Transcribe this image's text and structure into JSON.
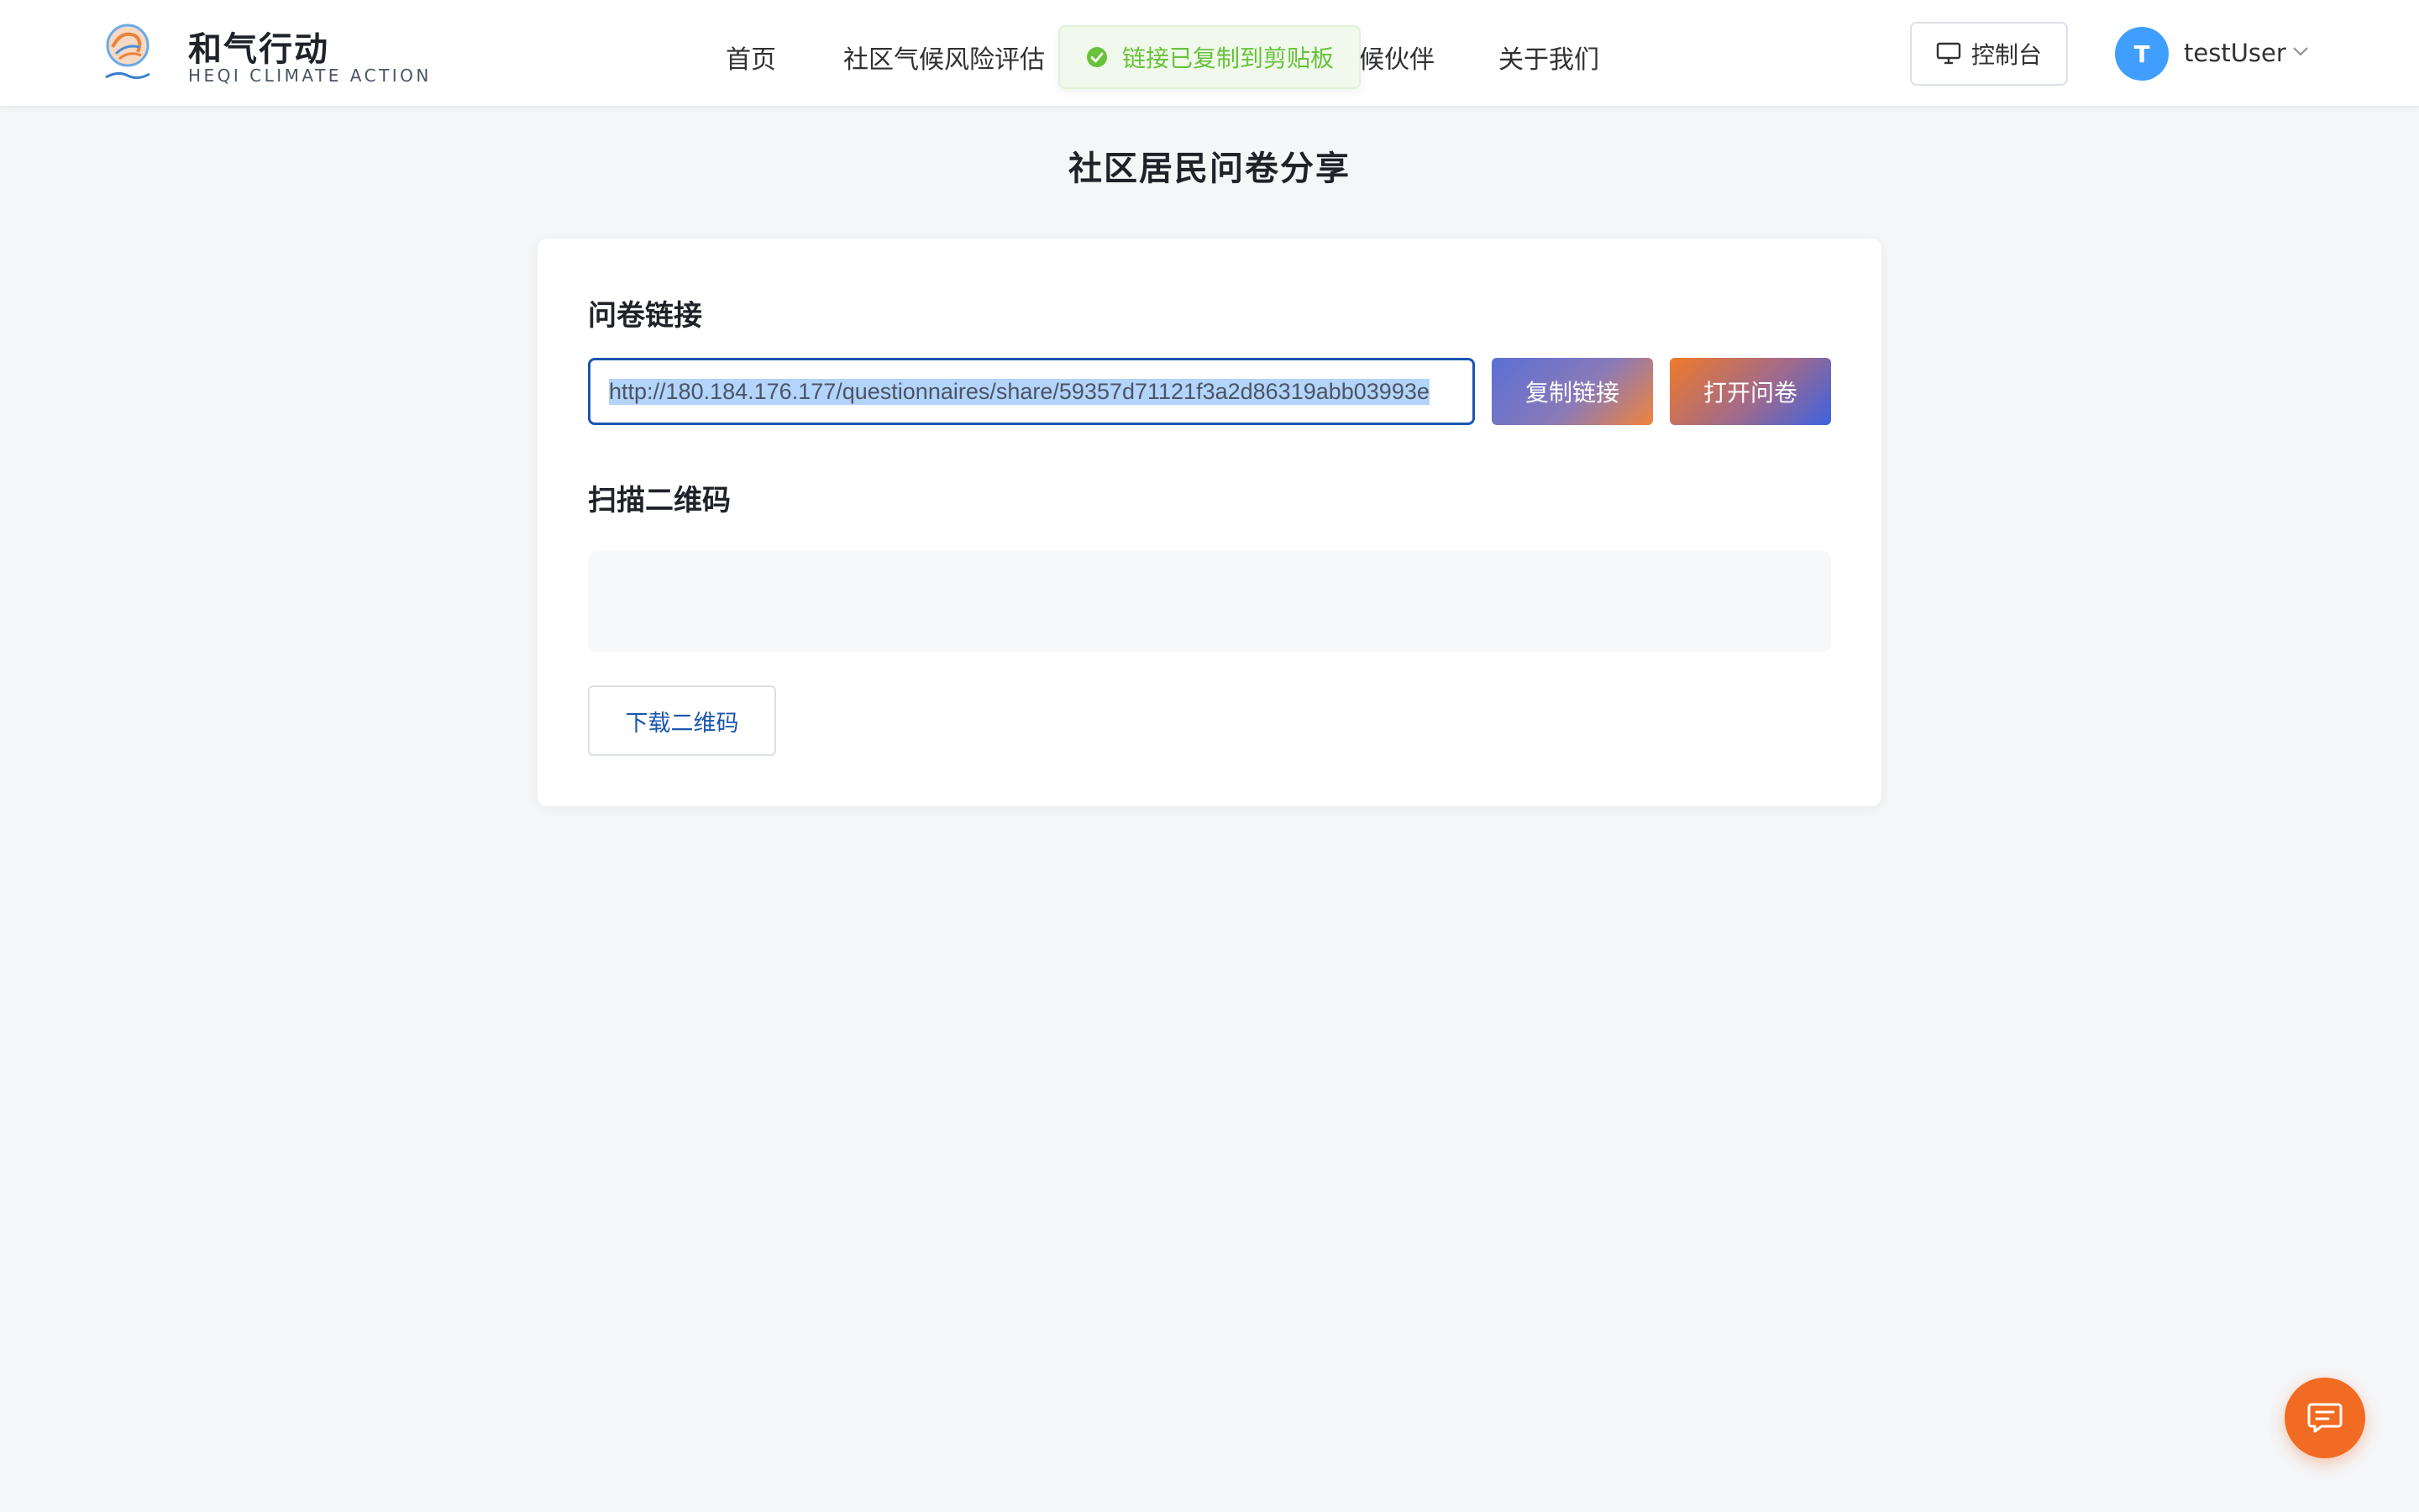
{
  "header": {
    "brand_name": "和气行动",
    "brand_sub": "HEQI CLIMATE ACTION",
    "nav": [
      {
        "label": "首页"
      },
      {
        "label": "社区气候风险评估"
      },
      {
        "label": "候伙伴"
      },
      {
        "label": "关于我们"
      }
    ],
    "console_label": "控制台",
    "avatar_initial": "T",
    "username": "testUser"
  },
  "toast": {
    "message": "链接已复制到剪贴板"
  },
  "main": {
    "page_title": "社区居民问卷分享",
    "link_section_title": "问卷链接",
    "link_value": "http://180.184.176.177/questionnaires/share/59357d71121f3a2d86319abb03993e",
    "copy_label": "复制链接",
    "open_label": "打开问卷",
    "qr_section_title": "扫描二维码",
    "download_label": "下载二维码"
  },
  "colors": {
    "accent_blue": "#1b55b0",
    "success_green": "#67c23a",
    "fab_orange": "#f26b22",
    "avatar_blue": "#409eff"
  }
}
